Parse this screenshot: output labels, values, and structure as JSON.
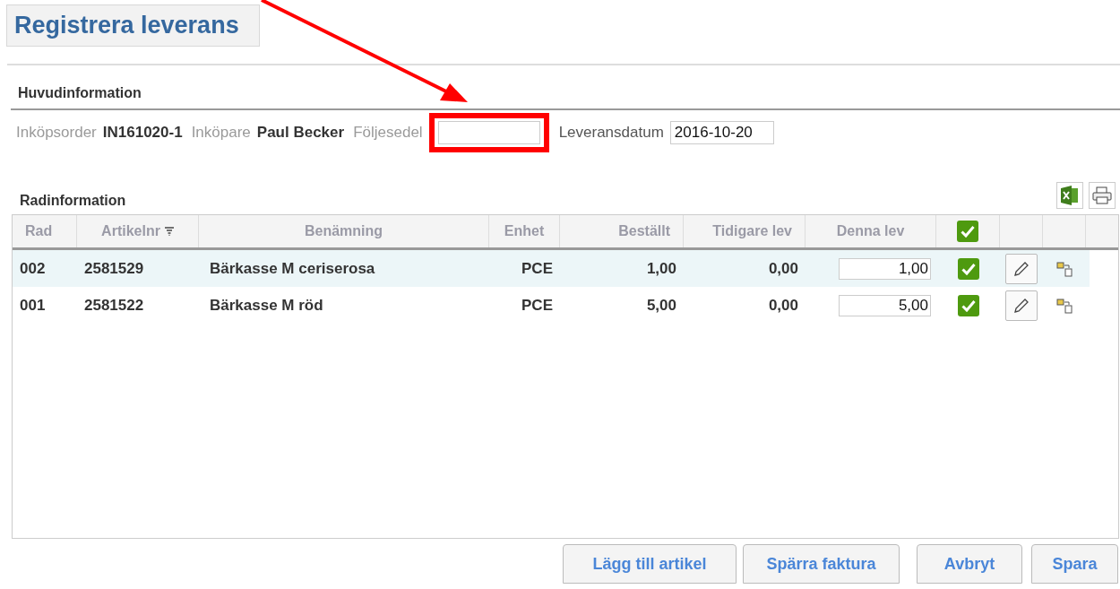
{
  "title": "Registrera leverans",
  "header_section": {
    "title": "Huvudinformation",
    "fields": [
      {
        "kind": "static",
        "label": "Inköpsorder",
        "value": "IN161020-1"
      },
      {
        "kind": "static",
        "label": "Inköpare",
        "value": "Paul Becker"
      },
      {
        "kind": "input",
        "label": "Följesedel",
        "highlighted": true
      },
      {
        "kind": "input",
        "label": "Leveransdatum",
        "value": "2016-10-20",
        "highlighted": false
      }
    ]
  },
  "rows_section": {
    "title": "Radinformation",
    "table": {
      "columns": [
        "Rad",
        "Artikelnr",
        "Benämning",
        "Enhet",
        "Beställt",
        "Tidigare lev",
        "Denna lev"
      ],
      "header_checked": true,
      "rows": [
        {
          "selected": true,
          "cells": [
            "002",
            "2581529",
            "Bärkasse M ceriserosa",
            "PCE",
            "1,00",
            "0,00"
          ],
          "quantity": "1,00",
          "checked": true
        },
        {
          "selected": false,
          "cells": [
            "001",
            "2581522",
            "Bärkasse M röd",
            "PCE",
            "5,00",
            "0,00"
          ],
          "quantity": "5,00",
          "checked": true
        }
      ]
    }
  },
  "buttons": [
    "Lägg till artikel",
    "Spärra faktura",
    "Avbryt",
    "Spara"
  ]
}
